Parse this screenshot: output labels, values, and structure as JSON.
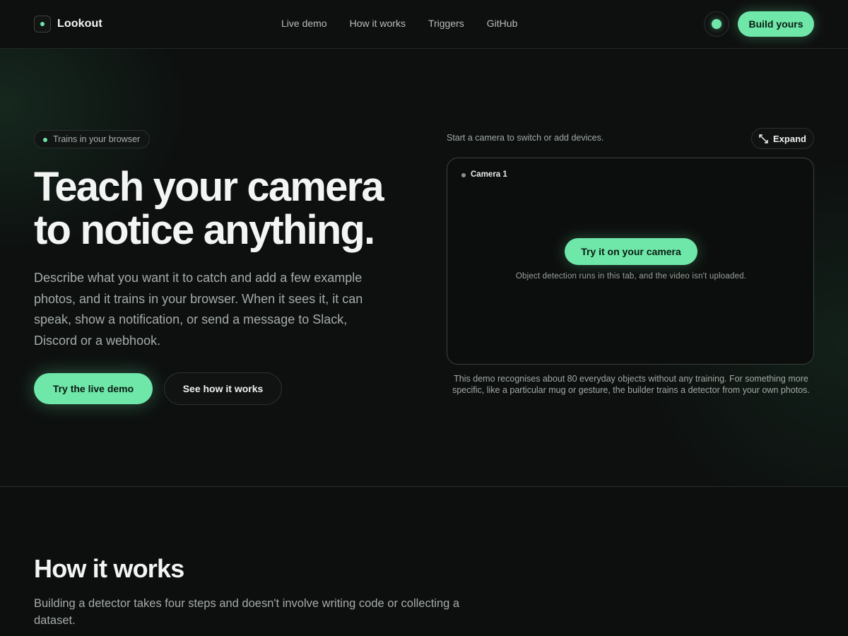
{
  "header": {
    "brand": "Lookout",
    "nav": [
      "Live demo",
      "How it works",
      "Triggers",
      "GitHub"
    ],
    "build_label": "Build yours"
  },
  "hero": {
    "badge": "Trains in your browser",
    "headline_line1": "Teach your camera",
    "headline_line2": "to notice anything.",
    "description": "Describe what you want it to catch and add a few example photos, and it trains in your browser. When it sees it, it can speak, show a notification, or send a message to Slack, Discord or a webhook.",
    "primary_cta": "Try the live demo",
    "secondary_cta": "See how it works"
  },
  "demo": {
    "hint": "Start a camera to switch or add devices.",
    "expand_label": "Expand",
    "camera_label": "Camera 1",
    "try_camera_label": "Try it on your camera",
    "camera_note": "Object detection runs in this tab, and the video isn't uploaded.",
    "caption": "This demo recognises about 80 everyday objects without any training. For something more specific, like a particular mug or gesture, the builder trains a detector from your own photos."
  },
  "how_it_works": {
    "title": "How it works",
    "subtitle": "Building a detector takes four steps and doesn't involve writing code or collecting a dataset."
  },
  "colors": {
    "accent": "#6ee7a8",
    "background": "#0d0f0e"
  },
  "icons": [
    "brand-mark-icon",
    "status-dot-icon",
    "expand-icon"
  ]
}
